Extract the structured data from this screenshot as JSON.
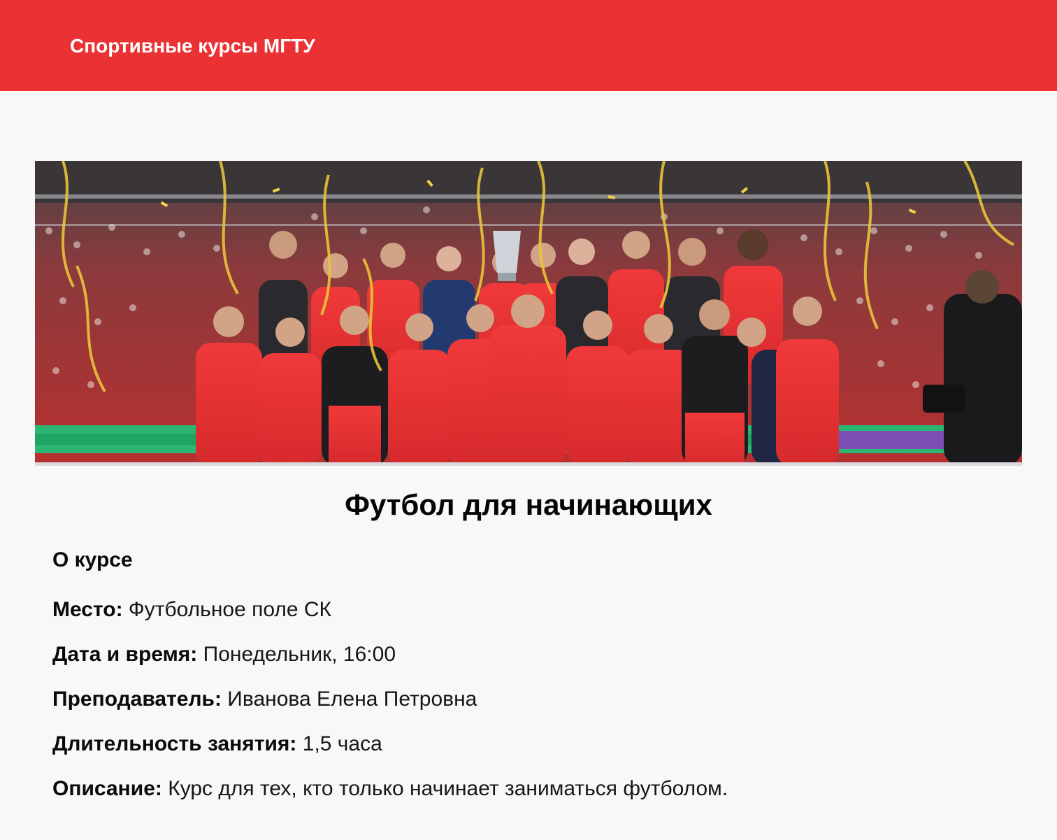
{
  "header": {
    "brand": "Спортивные курсы МГТУ",
    "background_color": "#ea3235"
  },
  "hero": {
    "image": "football-team-celebration-photo"
  },
  "course": {
    "title": "Футбол для начинающих",
    "section_title": "О курсе",
    "details": [
      {
        "label": "Место:",
        "value": "Футбольное поле СК"
      },
      {
        "label": "Дата и время:",
        "value": "Понедельник, 16:00"
      },
      {
        "label": "Преподаватель:",
        "value": "Иванова Елена Петровна"
      },
      {
        "label": "Длительность занятия:",
        "value": "1,5 часа"
      },
      {
        "label": "Описание:",
        "value": "Курс для тех, кто только начинает заниматься футболом."
      }
    ]
  }
}
